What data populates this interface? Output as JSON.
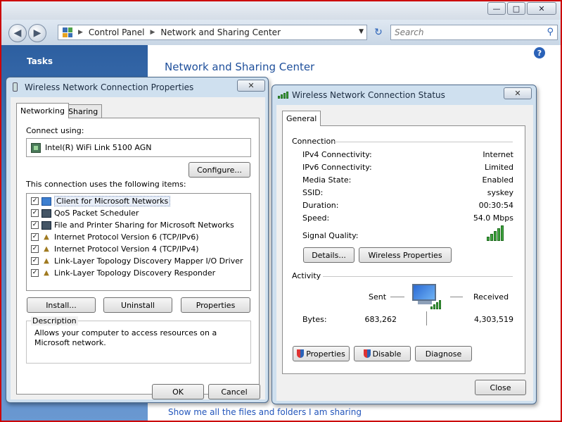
{
  "navbar": {
    "breadcrumb": [
      "Control Panel",
      "Network and Sharing Center"
    ],
    "search_placeholder": "Search"
  },
  "sidebar": {
    "tasks_label": "Tasks"
  },
  "main": {
    "title": "Network and Sharing Center",
    "bottom_link": "Show me all the files and folders I am sharing"
  },
  "props_dialog": {
    "title": "Wireless Network Connection Properties",
    "tabs": [
      "Networking",
      "Sharing"
    ],
    "connect_using_label": "Connect using:",
    "adapter": "Intel(R) WiFi Link 5100 AGN",
    "configure_label": "Configure...",
    "items_label": "This connection uses the following items:",
    "items": [
      {
        "label": "Client for Microsoft Networks",
        "icon": "network-client-icon",
        "checked": true
      },
      {
        "label": "QoS Packet Scheduler",
        "icon": "computer-icon",
        "checked": true
      },
      {
        "label": "File and Printer Sharing for Microsoft Networks",
        "icon": "computer-icon",
        "checked": true
      },
      {
        "label": "Internet Protocol Version 6 (TCP/IPv6)",
        "icon": "protocol-icon",
        "checked": true
      },
      {
        "label": "Internet Protocol Version 4 (TCP/IPv4)",
        "icon": "protocol-icon",
        "checked": true
      },
      {
        "label": "Link-Layer Topology Discovery Mapper I/O Driver",
        "icon": "protocol-icon",
        "checked": true
      },
      {
        "label": "Link-Layer Topology Discovery Responder",
        "icon": "protocol-icon",
        "checked": true
      }
    ],
    "install_label": "Install...",
    "uninstall_label": "Uninstall",
    "properties_label": "Properties",
    "description_legend": "Description",
    "description_text": "Allows your computer to access resources on a Microsoft network.",
    "ok_label": "OK",
    "cancel_label": "Cancel"
  },
  "status_dialog": {
    "title": "Wireless Network Connection Status",
    "tab": "General",
    "connection_legend": "Connection",
    "rows": [
      {
        "label": "IPv4 Connectivity:",
        "value": "Internet"
      },
      {
        "label": "IPv6 Connectivity:",
        "value": "Limited"
      },
      {
        "label": "Media State:",
        "value": "Enabled"
      },
      {
        "label": "SSID:",
        "value": "syskey"
      },
      {
        "label": "Duration:",
        "value": "00:30:54"
      },
      {
        "label": "Speed:",
        "value": "54.0 Mbps"
      }
    ],
    "signal_quality_label": "Signal Quality:",
    "details_label": "Details...",
    "wireless_props_label": "Wireless Properties",
    "activity_legend": "Activity",
    "sent_label": "Sent",
    "received_label": "Received",
    "bytes_label": "Bytes:",
    "bytes_sent": "683,262",
    "bytes_received": "4,303,519",
    "properties_label": "Properties",
    "disable_label": "Disable",
    "diagnose_label": "Diagnose",
    "close_label": "Close"
  },
  "colors": {
    "title_blue": "#1e4f9b",
    "sidebar_blue": "#2d5fa0",
    "signal_green": "#3ea53e"
  }
}
